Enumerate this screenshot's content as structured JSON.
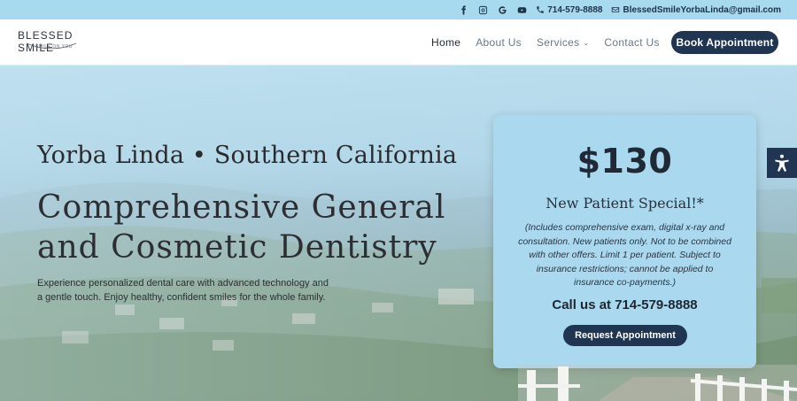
{
  "topbar": {
    "social": [
      {
        "name": "facebook-icon",
        "glyph": "f"
      },
      {
        "name": "instagram-icon",
        "glyph": ""
      },
      {
        "name": "google-icon",
        "glyph": "G"
      },
      {
        "name": "youtube-icon",
        "glyph": ""
      }
    ],
    "phone": "714-579-8888",
    "email": "BlessedSmileYorbaLinda@gmail.com"
  },
  "header": {
    "logo_main": "BLESSED SMILE",
    "logo_tag": "SMILE ON YOU",
    "nav": {
      "home": "Home",
      "about": "About Us",
      "services": "Services",
      "contact": "Contact Us"
    },
    "book_label": "Book Appointment"
  },
  "hero": {
    "kicker": "Yorba Linda • Southern California",
    "title": "Comprehensive General and Cosmetic Dentistry",
    "description": "Experience personalized dental care with advanced technology and a gentle touch. Enjoy healthy, confident smiles for the whole family."
  },
  "offer": {
    "price": "$130",
    "headline": "New Patient Special!*",
    "fineprint": "(Includes comprehensive exam, digital x-ray and consultation. New patients only. Not to be combined with other offers. Limit 1 per patient. Subject to insurance restrictions; cannot be applied to insurance co-payments.)",
    "call": "Call us at 714-579-8888",
    "request_label": "Request Appointment"
  },
  "colors": {
    "navy": "#1f3551",
    "sky": "#a9d8ef",
    "topbar": "#a7d9ef"
  }
}
